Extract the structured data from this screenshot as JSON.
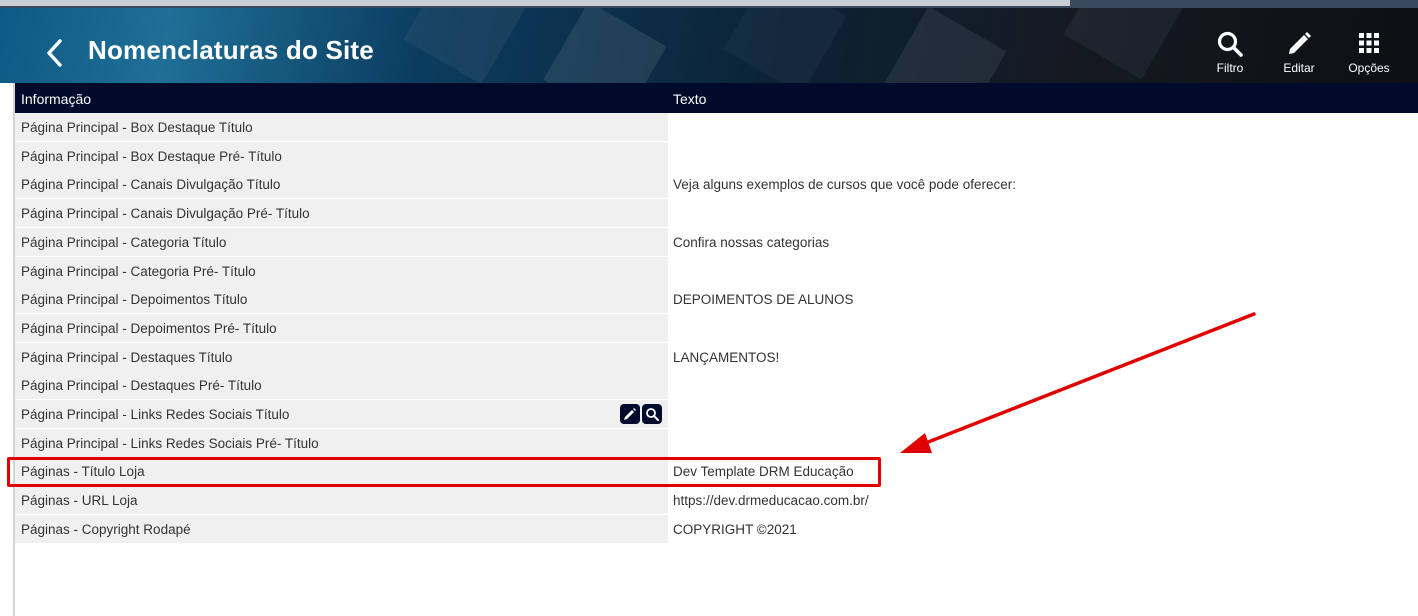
{
  "header": {
    "title": "Nomenclaturas do Site",
    "back_icon": "chevron-left-icon",
    "tools": [
      {
        "label": "Filtro",
        "icon": "search-icon"
      },
      {
        "label": "Editar",
        "icon": "pencil-icon"
      },
      {
        "label": "Opções",
        "icon": "grid-icon"
      }
    ]
  },
  "table": {
    "columns": [
      "Informação",
      "Texto"
    ],
    "rows": [
      {
        "info": "Página Principal - Box Destaque Título",
        "texto": ""
      },
      {
        "info": "Página Principal - Box Destaque Pré- Título",
        "texto": ""
      },
      {
        "info": "Página Principal - Canais Divulgação Título",
        "texto": "Veja alguns exemplos de cursos que você pode oferecer:"
      },
      {
        "info": "Página Principal - Canais Divulgação Pré- Título",
        "texto": ""
      },
      {
        "info": "Página Principal - Categoria Título",
        "texto": "Confira nossas categorias"
      },
      {
        "info": "Página Principal - Categoria Pré- Título",
        "texto": ""
      },
      {
        "info": "Página Principal - Depoimentos Título",
        "texto": "DEPOIMENTOS DE ALUNOS"
      },
      {
        "info": "Página Principal - Depoimentos Pré- Título",
        "texto": ""
      },
      {
        "info": "Página Principal - Destaques Título",
        "texto": "LANÇAMENTOS!"
      },
      {
        "info": "Página Principal - Destaques Pré- Título",
        "texto": ""
      },
      {
        "info": "Página Principal - Links Redes Sociais Título",
        "texto": ""
      },
      {
        "info": "Página Principal - Links Redes Sociais Pré- Título",
        "texto": ""
      },
      {
        "info": "Páginas - Título Loja",
        "texto": "Dev Template DRM Educação"
      },
      {
        "info": "Páginas - URL Loja",
        "texto": "https://dev.drmeducacao.com.br/"
      },
      {
        "info": "Páginas - Copyright Rodapé",
        "texto": "COPYRIGHT ©2021"
      }
    ],
    "row_actions": {
      "row": "Página Principal - Links Redes Sociais Título",
      "icons": [
        "pencil-icon",
        "search-icon"
      ]
    }
  },
  "annotation": {
    "color": "#e00000",
    "highlighted_row": "Páginas - Título Loja"
  },
  "colors": {
    "header_bar": "#000a2a",
    "info_cell": "#f0f0f0",
    "accent": "#e00000"
  }
}
